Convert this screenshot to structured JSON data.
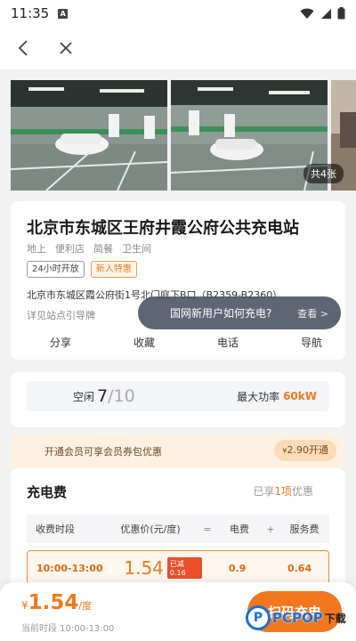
{
  "status_bar": {
    "time": "11:35",
    "notification_icon": "A"
  },
  "nav": {
    "back_icon": "arrow-left-icon",
    "close_icon": "close-icon"
  },
  "gallery": {
    "photo_count": "共4张"
  },
  "station": {
    "name": "北京市东城区王府井霞公府公共充电站",
    "plain_tags": [
      "地上",
      "便利店",
      "简餐",
      "卫生间"
    ],
    "box_tags": [
      "24小时开放",
      "新人特惠"
    ],
    "address": "北京市东城区霞公府街1号北门庭下B口（B2359-B2360）",
    "guide_label": "详见站点引导牌"
  },
  "actions": [
    "分享",
    "收藏",
    "电话",
    "导航"
  ],
  "popover": {
    "text": "国网新用户如何充电?",
    "more": "查看 >"
  },
  "stats": {
    "free_label": "空闲",
    "free_count": "7",
    "total": "/10",
    "power_label": "最大功率",
    "power_value": "60kW"
  },
  "member": {
    "text": "开通会员可享会员券包优惠",
    "currency": "¥",
    "price": "2.90",
    "cta": "开通"
  },
  "fee": {
    "title": "充电费",
    "discount_prefix": "已享",
    "discount_count": "1项",
    "discount_suffix": "优惠",
    "headers": [
      "收费时段",
      "优惠价(元/度)",
      "=",
      "电费",
      "+",
      "服务费"
    ],
    "current_row": {
      "period": "10:00-13:00",
      "price": "1.54",
      "reduced": "已减0.16",
      "electricity": "0.9",
      "service": "0.64"
    }
  },
  "bottom": {
    "currency": "¥",
    "price": "1.54",
    "unit": "/度",
    "period_label": "当前时段 10:00-13:00",
    "cta": "扫码充电"
  },
  "watermark": {
    "text": "PCPOP",
    "suffix": "下载"
  },
  "colors": {
    "accent": "#ee7a1f",
    "member_bg": "#fff1e2"
  }
}
